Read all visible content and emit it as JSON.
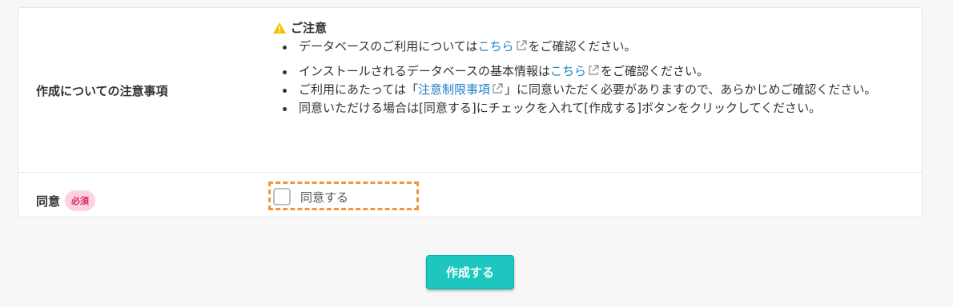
{
  "form": {
    "notes_label": "作成についての注意事項",
    "notice_title": "ご注意",
    "bullet1": {
      "before": "データベースのご利用については",
      "link": "こちら",
      "after": "をご確認ください。"
    },
    "bullet2": {
      "before": "インストールされるデータベースの基本情報は",
      "link": "こちら",
      "after": "をご確認ください。"
    },
    "bullet3": {
      "before": "ご利用にあたっては「",
      "link": "注意制限事項",
      "after": "」に同意いただく必要がありますので、あらかじめご確認ください。"
    },
    "bullet4": "同意いただける場合は[同意する]にチェックを入れて[作成する]ボタンをクリックしてください。",
    "agree_label": "同意",
    "required_badge": "必須",
    "agree_checkbox_text": "同意する",
    "agree_checked": false
  },
  "submit_label": "作成する",
  "colors": {
    "accent": "#1dc7c0",
    "link": "#1f7fc7",
    "required": "#e0245e",
    "highlight": "#f0973a",
    "warning": "#f2c200"
  },
  "icons": {
    "warning": "warning-triangle-icon",
    "external": "external-link-icon"
  }
}
